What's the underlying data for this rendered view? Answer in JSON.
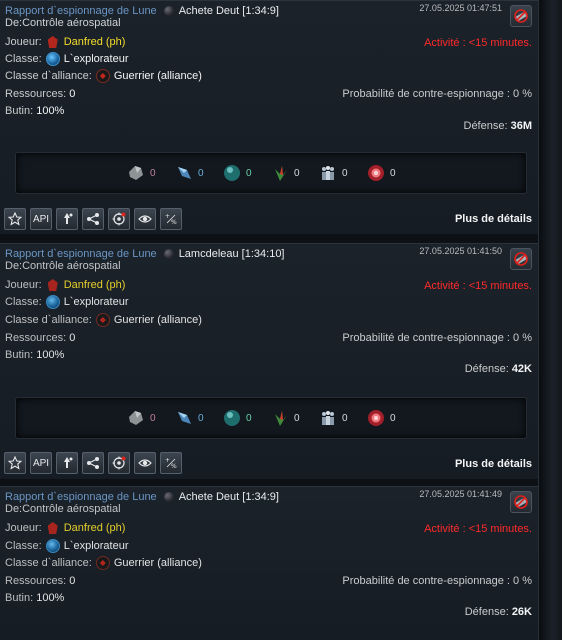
{
  "common": {
    "delete_label": "",
    "details_label": "Plus de détails",
    "api_label": "API"
  },
  "reports": [
    {
      "title": "Rapport d`espionnage de Lune",
      "planet": "Achete Deut [1:34:9]",
      "date": "27.05.2025 01:47:51",
      "from": "De:Contrôle aérospatial",
      "player_label": "Joueur:",
      "player": "Danfred (ph)",
      "activity": "Activité : <15 minutes.",
      "class_label": "Classe:",
      "class": "L`explorateur",
      "alliance_class_label": "Classe d`alliance:",
      "alliance_class": "Guerrier (alliance)",
      "resources_label": "Ressources:",
      "resources": "0",
      "counter_label": "Probabilité de contre-espionnage :",
      "counter": "0 %",
      "loot_label": "Butin:",
      "loot": "100%",
      "defense_label": "Défense:",
      "defense": "36M",
      "debris": [
        "0",
        "0",
        "0",
        "0",
        "0",
        "0"
      ]
    },
    {
      "title": "Rapport d`espionnage de Lune",
      "planet": "Lamcdeleau [1:34:10]",
      "date": "27.05.2025 01:41:50",
      "from": "De:Contrôle aérospatial",
      "player_label": "Joueur:",
      "player": "Danfred (ph)",
      "activity": "Activité : <15 minutes.",
      "class_label": "Classe:",
      "class": "L`explorateur",
      "alliance_class_label": "Classe d`alliance:",
      "alliance_class": "Guerrier (alliance)",
      "resources_label": "Ressources:",
      "resources": "0",
      "counter_label": "Probabilité de contre-espionnage :",
      "counter": "0 %",
      "loot_label": "Butin:",
      "loot": "100%",
      "defense_label": "Défense:",
      "defense": "42K",
      "debris": [
        "0",
        "0",
        "0",
        "0",
        "0",
        "0"
      ]
    },
    {
      "title": "Rapport d`espionnage de Lune",
      "planet": "Achete Deut [1:34:9]",
      "date": "27.05.2025 01:41:49",
      "from": "De:Contrôle aérospatial",
      "player_label": "Joueur:",
      "player": "Danfred (ph)",
      "activity": "Activité : <15 minutes.",
      "class_label": "Classe:",
      "class": "L`explorateur",
      "alliance_class_label": "Classe d`alliance:",
      "alliance_class": "Guerrier (alliance)",
      "resources_label": "Ressources:",
      "resources": "0",
      "counter_label": "Probabilité de contre-espionnage :",
      "counter": "0 %",
      "loot_label": "Butin:",
      "loot": "100%",
      "defense_label": "Défense:",
      "defense": "26K"
    }
  ],
  "icons": {
    "debris": [
      "metal-icon",
      "crystal-icon",
      "deuterium-icon",
      "food-icon",
      "population-icon",
      "energy-icon"
    ],
    "toolbar": [
      "favorite-star-icon",
      "api-icon",
      "attack-icon",
      "share-icon",
      "espionage-icon",
      "view-icon",
      "simulate-icon"
    ]
  },
  "colors": {
    "link_blue": "#6b96c4",
    "player_gold": "#f5dd2b",
    "activity_red": "#ff2a2a"
  }
}
